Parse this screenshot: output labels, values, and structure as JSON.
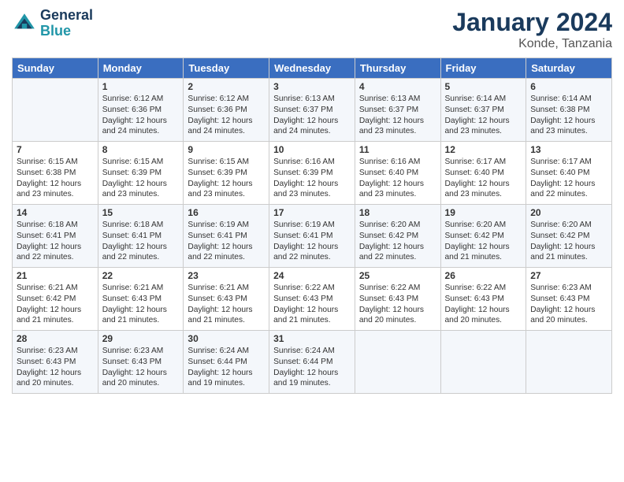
{
  "header": {
    "logo_line1": "General",
    "logo_line2": "Blue",
    "month_title": "January 2024",
    "location": "Konde, Tanzania"
  },
  "weekdays": [
    "Sunday",
    "Monday",
    "Tuesday",
    "Wednesday",
    "Thursday",
    "Friday",
    "Saturday"
  ],
  "weeks": [
    [
      {
        "day": "",
        "sunrise": "",
        "sunset": "",
        "daylight": ""
      },
      {
        "day": "1",
        "sunrise": "Sunrise: 6:12 AM",
        "sunset": "Sunset: 6:36 PM",
        "daylight": "Daylight: 12 hours and 24 minutes."
      },
      {
        "day": "2",
        "sunrise": "Sunrise: 6:12 AM",
        "sunset": "Sunset: 6:36 PM",
        "daylight": "Daylight: 12 hours and 24 minutes."
      },
      {
        "day": "3",
        "sunrise": "Sunrise: 6:13 AM",
        "sunset": "Sunset: 6:37 PM",
        "daylight": "Daylight: 12 hours and 24 minutes."
      },
      {
        "day": "4",
        "sunrise": "Sunrise: 6:13 AM",
        "sunset": "Sunset: 6:37 PM",
        "daylight": "Daylight: 12 hours and 23 minutes."
      },
      {
        "day": "5",
        "sunrise": "Sunrise: 6:14 AM",
        "sunset": "Sunset: 6:37 PM",
        "daylight": "Daylight: 12 hours and 23 minutes."
      },
      {
        "day": "6",
        "sunrise": "Sunrise: 6:14 AM",
        "sunset": "Sunset: 6:38 PM",
        "daylight": "Daylight: 12 hours and 23 minutes."
      }
    ],
    [
      {
        "day": "7",
        "sunrise": "Sunrise: 6:15 AM",
        "sunset": "Sunset: 6:38 PM",
        "daylight": "Daylight: 12 hours and 23 minutes."
      },
      {
        "day": "8",
        "sunrise": "Sunrise: 6:15 AM",
        "sunset": "Sunset: 6:39 PM",
        "daylight": "Daylight: 12 hours and 23 minutes."
      },
      {
        "day": "9",
        "sunrise": "Sunrise: 6:15 AM",
        "sunset": "Sunset: 6:39 PM",
        "daylight": "Daylight: 12 hours and 23 minutes."
      },
      {
        "day": "10",
        "sunrise": "Sunrise: 6:16 AM",
        "sunset": "Sunset: 6:39 PM",
        "daylight": "Daylight: 12 hours and 23 minutes."
      },
      {
        "day": "11",
        "sunrise": "Sunrise: 6:16 AM",
        "sunset": "Sunset: 6:40 PM",
        "daylight": "Daylight: 12 hours and 23 minutes."
      },
      {
        "day": "12",
        "sunrise": "Sunrise: 6:17 AM",
        "sunset": "Sunset: 6:40 PM",
        "daylight": "Daylight: 12 hours and 23 minutes."
      },
      {
        "day": "13",
        "sunrise": "Sunrise: 6:17 AM",
        "sunset": "Sunset: 6:40 PM",
        "daylight": "Daylight: 12 hours and 22 minutes."
      }
    ],
    [
      {
        "day": "14",
        "sunrise": "Sunrise: 6:18 AM",
        "sunset": "Sunset: 6:41 PM",
        "daylight": "Daylight: 12 hours and 22 minutes."
      },
      {
        "day": "15",
        "sunrise": "Sunrise: 6:18 AM",
        "sunset": "Sunset: 6:41 PM",
        "daylight": "Daylight: 12 hours and 22 minutes."
      },
      {
        "day": "16",
        "sunrise": "Sunrise: 6:19 AM",
        "sunset": "Sunset: 6:41 PM",
        "daylight": "Daylight: 12 hours and 22 minutes."
      },
      {
        "day": "17",
        "sunrise": "Sunrise: 6:19 AM",
        "sunset": "Sunset: 6:41 PM",
        "daylight": "Daylight: 12 hours and 22 minutes."
      },
      {
        "day": "18",
        "sunrise": "Sunrise: 6:20 AM",
        "sunset": "Sunset: 6:42 PM",
        "daylight": "Daylight: 12 hours and 22 minutes."
      },
      {
        "day": "19",
        "sunrise": "Sunrise: 6:20 AM",
        "sunset": "Sunset: 6:42 PM",
        "daylight": "Daylight: 12 hours and 21 minutes."
      },
      {
        "day": "20",
        "sunrise": "Sunrise: 6:20 AM",
        "sunset": "Sunset: 6:42 PM",
        "daylight": "Daylight: 12 hours and 21 minutes."
      }
    ],
    [
      {
        "day": "21",
        "sunrise": "Sunrise: 6:21 AM",
        "sunset": "Sunset: 6:42 PM",
        "daylight": "Daylight: 12 hours and 21 minutes."
      },
      {
        "day": "22",
        "sunrise": "Sunrise: 6:21 AM",
        "sunset": "Sunset: 6:43 PM",
        "daylight": "Daylight: 12 hours and 21 minutes."
      },
      {
        "day": "23",
        "sunrise": "Sunrise: 6:21 AM",
        "sunset": "Sunset: 6:43 PM",
        "daylight": "Daylight: 12 hours and 21 minutes."
      },
      {
        "day": "24",
        "sunrise": "Sunrise: 6:22 AM",
        "sunset": "Sunset: 6:43 PM",
        "daylight": "Daylight: 12 hours and 21 minutes."
      },
      {
        "day": "25",
        "sunrise": "Sunrise: 6:22 AM",
        "sunset": "Sunset: 6:43 PM",
        "daylight": "Daylight: 12 hours and 20 minutes."
      },
      {
        "day": "26",
        "sunrise": "Sunrise: 6:22 AM",
        "sunset": "Sunset: 6:43 PM",
        "daylight": "Daylight: 12 hours and 20 minutes."
      },
      {
        "day": "27",
        "sunrise": "Sunrise: 6:23 AM",
        "sunset": "Sunset: 6:43 PM",
        "daylight": "Daylight: 12 hours and 20 minutes."
      }
    ],
    [
      {
        "day": "28",
        "sunrise": "Sunrise: 6:23 AM",
        "sunset": "Sunset: 6:43 PM",
        "daylight": "Daylight: 12 hours and 20 minutes."
      },
      {
        "day": "29",
        "sunrise": "Sunrise: 6:23 AM",
        "sunset": "Sunset: 6:43 PM",
        "daylight": "Daylight: 12 hours and 20 minutes."
      },
      {
        "day": "30",
        "sunrise": "Sunrise: 6:24 AM",
        "sunset": "Sunset: 6:44 PM",
        "daylight": "Daylight: 12 hours and 19 minutes."
      },
      {
        "day": "31",
        "sunrise": "Sunrise: 6:24 AM",
        "sunset": "Sunset: 6:44 PM",
        "daylight": "Daylight: 12 hours and 19 minutes."
      },
      {
        "day": "",
        "sunrise": "",
        "sunset": "",
        "daylight": ""
      },
      {
        "day": "",
        "sunrise": "",
        "sunset": "",
        "daylight": ""
      },
      {
        "day": "",
        "sunrise": "",
        "sunset": "",
        "daylight": ""
      }
    ]
  ]
}
